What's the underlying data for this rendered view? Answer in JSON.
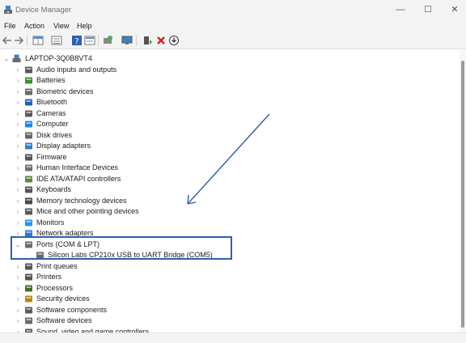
{
  "window": {
    "title": "Device Manager",
    "controls": [
      "minimize-icon",
      "maximize-icon",
      "close-icon"
    ]
  },
  "menu": [
    "File",
    "Action",
    "View",
    "Help"
  ],
  "toolbar_icons": [
    "back-icon",
    "forward-icon",
    "properties-grid-icon",
    "list-view-icon",
    "help-icon",
    "details-view-icon",
    "scan-hardware-icon",
    "monitor-icon",
    "enable-device-icon",
    "uninstall-icon",
    "update-driver-icon"
  ],
  "tree": {
    "root": "LAPTOP-3Q0B8VT4",
    "categories": [
      {
        "label": "Audio inputs and outputs",
        "icon": "speaker-icon",
        "color": "#5a5a5a"
      },
      {
        "label": "Batteries",
        "icon": "battery-icon",
        "color": "#3a8f2a"
      },
      {
        "label": "Biometric devices",
        "icon": "fingerprint-icon",
        "color": "#6a6a6a"
      },
      {
        "label": "Bluetooth",
        "icon": "bluetooth-icon",
        "color": "#1565c0"
      },
      {
        "label": "Cameras",
        "icon": "camera-icon",
        "color": "#5c5c5c"
      },
      {
        "label": "Computer",
        "icon": "computer-icon",
        "color": "#1e88e5"
      },
      {
        "label": "Disk drives",
        "icon": "disk-drive-icon",
        "color": "#666666"
      },
      {
        "label": "Display adapters",
        "icon": "display-adapter-icon",
        "color": "#2f7fd0"
      },
      {
        "label": "Firmware",
        "icon": "firmware-icon",
        "color": "#555555"
      },
      {
        "label": "Human Interface Devices",
        "icon": "hid-icon",
        "color": "#707070"
      },
      {
        "label": "IDE ATA/ATAPI controllers",
        "icon": "ide-controller-icon",
        "color": "#5d8a3a"
      },
      {
        "label": "Keyboards",
        "icon": "keyboard-icon",
        "color": "#555555"
      },
      {
        "label": "Memory technology devices",
        "icon": "memory-icon",
        "color": "#4a4a4a"
      },
      {
        "label": "Mice and other pointing devices",
        "icon": "mouse-icon",
        "color": "#5a5a5a"
      },
      {
        "label": "Monitors",
        "icon": "monitor-icon",
        "color": "#2196f3"
      },
      {
        "label": "Network adapters",
        "icon": "network-adapter-icon",
        "color": "#2a7ad5"
      },
      {
        "label": "Ports (COM & LPT)",
        "icon": "port-icon",
        "color": "#6a6a6a",
        "expanded": true,
        "children": [
          {
            "label": "Silicon Labs CP210x USB to UART Bridge (COM5)",
            "icon": "port-icon",
            "color": "#6a6a6a"
          }
        ]
      },
      {
        "label": "Print queues",
        "icon": "print-queue-icon",
        "color": "#555555"
      },
      {
        "label": "Printers",
        "icon": "printer-icon",
        "color": "#555555"
      },
      {
        "label": "Processors",
        "icon": "processor-icon",
        "color": "#3c6e2a"
      },
      {
        "label": "Security devices",
        "icon": "security-device-icon",
        "color": "#b8860b"
      },
      {
        "label": "Software components",
        "icon": "software-component-icon",
        "color": "#5a5a5a"
      },
      {
        "label": "Software devices",
        "icon": "software-device-icon",
        "color": "#6a6a6a"
      },
      {
        "label": "Sound, video and game controllers",
        "icon": "sound-controller-icon",
        "color": "#5a5a5a"
      }
    ]
  },
  "annotation": {
    "color": "#2f5fa8"
  }
}
